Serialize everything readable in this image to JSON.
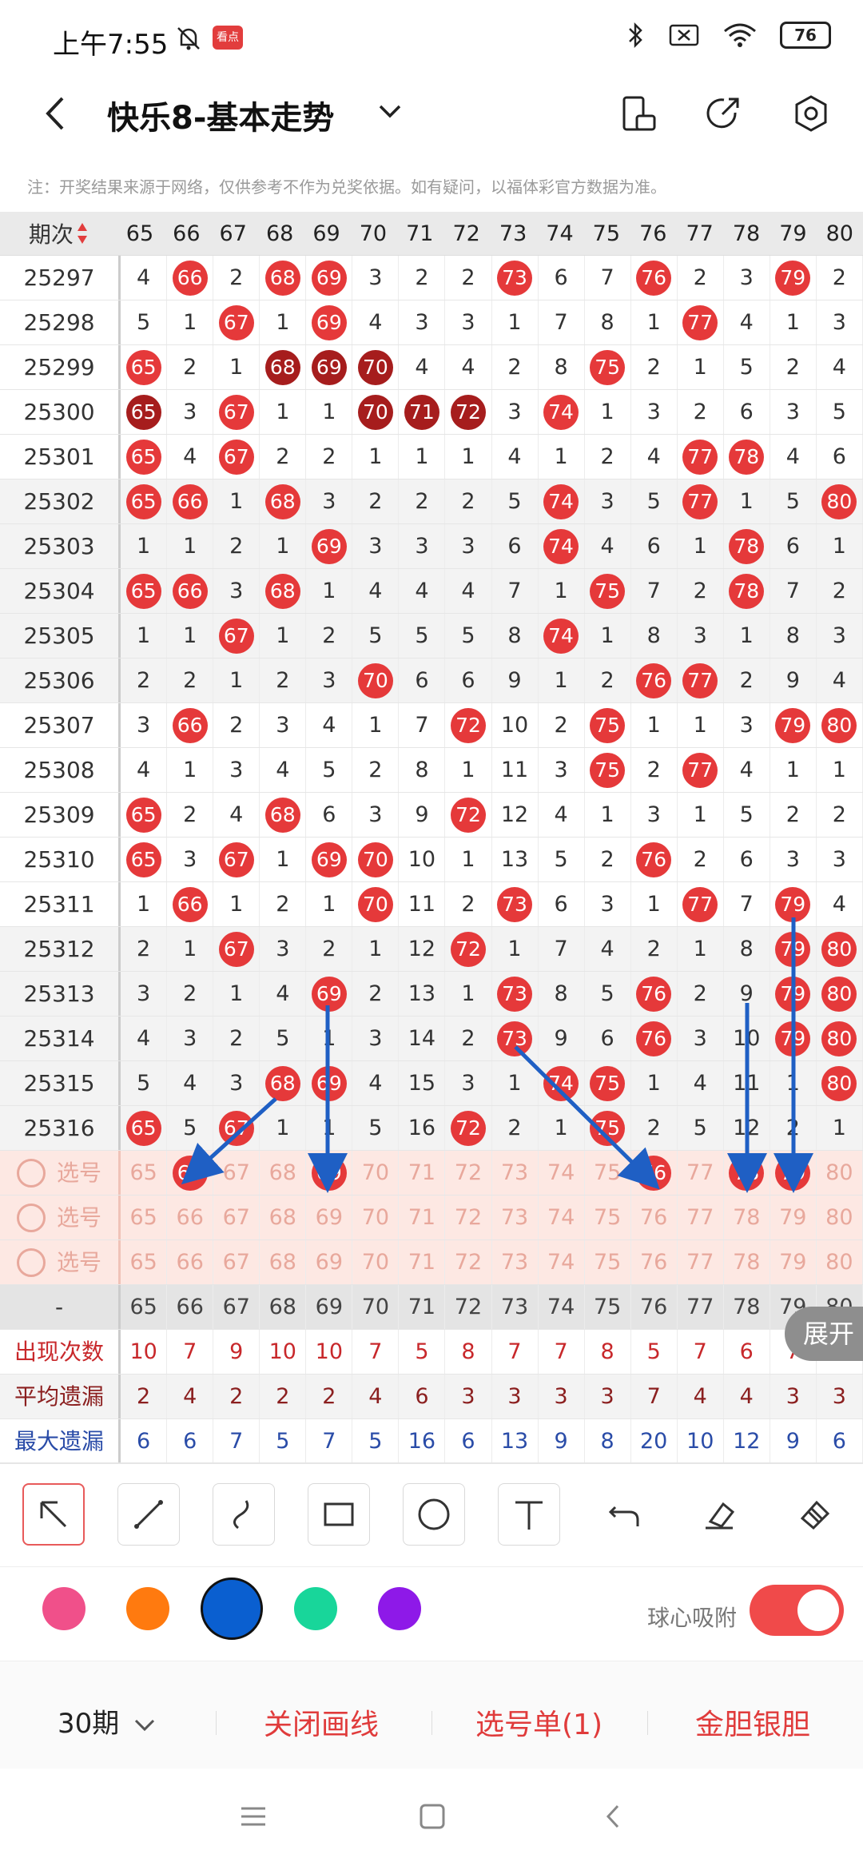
{
  "status_bar": {
    "time": "上午7:55",
    "app_badge": "看点",
    "battery": "76"
  },
  "header": {
    "title": "快乐8-基本走势"
  },
  "note": "注：开奖结果来源于网络，仅供参考不作为兑奖依据。如有疑问，以福体彩官方数据为准。",
  "table": {
    "period_header": "期次",
    "columns": [
      "65",
      "66",
      "67",
      "68",
      "69",
      "70",
      "71",
      "72",
      "73",
      "74",
      "75",
      "76",
      "77",
      "78",
      "79",
      "80"
    ],
    "rows": [
      {
        "period": "25297",
        "cells": [
          "4",
          "66",
          "2",
          "68",
          "69",
          "3",
          "2",
          "2",
          "73",
          "6",
          "7",
          "76",
          "2",
          "3",
          "79",
          "2"
        ]
      },
      {
        "period": "25298",
        "cells": [
          "5",
          "1",
          "67",
          "1",
          "69",
          "4",
          "3",
          "3",
          "1",
          "7",
          "8",
          "1",
          "77",
          "4",
          "1",
          "3"
        ]
      },
      {
        "period": "25299",
        "cells": [
          "65",
          "2",
          "1",
          "68",
          "69",
          "70",
          "4",
          "4",
          "2",
          "8",
          "75",
          "2",
          "1",
          "5",
          "2",
          "4"
        ]
      },
      {
        "period": "25300",
        "cells": [
          "65",
          "3",
          "67",
          "1",
          "1",
          "70",
          "71",
          "72",
          "3",
          "74",
          "1",
          "3",
          "2",
          "6",
          "3",
          "5"
        ]
      },
      {
        "period": "25301",
        "cells": [
          "65",
          "4",
          "67",
          "2",
          "2",
          "1",
          "1",
          "1",
          "4",
          "1",
          "2",
          "4",
          "77",
          "78",
          "4",
          "6"
        ]
      },
      {
        "period": "25302",
        "cells": [
          "65",
          "66",
          "1",
          "68",
          "3",
          "2",
          "2",
          "2",
          "5",
          "74",
          "3",
          "5",
          "77",
          "1",
          "5",
          "80"
        ]
      },
      {
        "period": "25303",
        "cells": [
          "1",
          "1",
          "2",
          "1",
          "69",
          "3",
          "3",
          "3",
          "6",
          "74",
          "4",
          "6",
          "1",
          "78",
          "6",
          "1"
        ]
      },
      {
        "period": "25304",
        "cells": [
          "65",
          "66",
          "3",
          "68",
          "1",
          "4",
          "4",
          "4",
          "7",
          "1",
          "75",
          "7",
          "2",
          "78",
          "7",
          "2"
        ]
      },
      {
        "period": "25305",
        "cells": [
          "1",
          "1",
          "67",
          "1",
          "2",
          "5",
          "5",
          "5",
          "8",
          "74",
          "1",
          "8",
          "3",
          "1",
          "8",
          "3"
        ]
      },
      {
        "period": "25306",
        "cells": [
          "2",
          "2",
          "1",
          "2",
          "3",
          "70",
          "6",
          "6",
          "9",
          "1",
          "2",
          "76",
          "77",
          "2",
          "9",
          "4"
        ]
      },
      {
        "period": "25307",
        "cells": [
          "3",
          "66",
          "2",
          "3",
          "4",
          "1",
          "7",
          "72",
          "10",
          "2",
          "75",
          "1",
          "1",
          "3",
          "79",
          "80"
        ]
      },
      {
        "period": "25308",
        "cells": [
          "4",
          "1",
          "3",
          "4",
          "5",
          "2",
          "8",
          "1",
          "11",
          "3",
          "75",
          "2",
          "77",
          "4",
          "1",
          "1"
        ]
      },
      {
        "period": "25309",
        "cells": [
          "65",
          "2",
          "4",
          "68",
          "6",
          "3",
          "9",
          "72",
          "12",
          "4",
          "1",
          "3",
          "1",
          "5",
          "2",
          "2"
        ]
      },
      {
        "period": "25310",
        "cells": [
          "65",
          "3",
          "67",
          "1",
          "69",
          "70",
          "10",
          "1",
          "13",
          "5",
          "2",
          "76",
          "2",
          "6",
          "3",
          "3"
        ]
      },
      {
        "period": "25311",
        "cells": [
          "1",
          "66",
          "1",
          "2",
          "1",
          "70",
          "11",
          "2",
          "73",
          "6",
          "3",
          "1",
          "77",
          "7",
          "79",
          "4"
        ]
      },
      {
        "period": "25312",
        "cells": [
          "2",
          "1",
          "67",
          "3",
          "2",
          "1",
          "12",
          "72",
          "1",
          "7",
          "4",
          "2",
          "1",
          "8",
          "79",
          "80"
        ]
      },
      {
        "period": "25313",
        "cells": [
          "3",
          "2",
          "1",
          "4",
          "69",
          "2",
          "13",
          "1",
          "73",
          "8",
          "5",
          "76",
          "2",
          "9",
          "79",
          "80"
        ]
      },
      {
        "period": "25314",
        "cells": [
          "4",
          "3",
          "2",
          "5",
          "1",
          "3",
          "14",
          "2",
          "73",
          "9",
          "6",
          "76",
          "3",
          "10",
          "79",
          "80"
        ]
      },
      {
        "period": "25315",
        "cells": [
          "5",
          "4",
          "3",
          "68",
          "69",
          "4",
          "15",
          "3",
          "1",
          "74",
          "75",
          "1",
          "4",
          "11",
          "1",
          "80"
        ]
      },
      {
        "period": "25316",
        "cells": [
          "65",
          "5",
          "67",
          "1",
          "1",
          "5",
          "16",
          "72",
          "2",
          "1",
          "75",
          "2",
          "5",
          "12",
          "2",
          "1"
        ]
      }
    ],
    "dark_balls": [
      "25299-68",
      "25299-69",
      "25299-70",
      "25300-65",
      "25300-70",
      "25300-71",
      "25300-72"
    ],
    "select_label": "选号",
    "select_rows": [
      {
        "picked": [
          "66",
          "69",
          "76",
          "78",
          "79"
        ]
      },
      {
        "picked": []
      },
      {
        "picked": []
      }
    ],
    "footer_dash": "-",
    "stats": [
      {
        "label": "出现次数",
        "values": [
          "10",
          "7",
          "9",
          "10",
          "10",
          "7",
          "5",
          "8",
          "7",
          "7",
          "8",
          "5",
          "7",
          "6",
          "7",
          "8"
        ]
      },
      {
        "label": "平均遗漏",
        "values": [
          "2",
          "4",
          "2",
          "2",
          "2",
          "4",
          "6",
          "3",
          "3",
          "3",
          "3",
          "7",
          "4",
          "4",
          "3",
          "3"
        ]
      },
      {
        "label": "最大遗漏",
        "values": [
          "6",
          "6",
          "7",
          "5",
          "7",
          "5",
          "16",
          "6",
          "13",
          "9",
          "8",
          "20",
          "10",
          "12",
          "9",
          "6"
        ]
      }
    ],
    "expand_label": "展开"
  },
  "tools": {
    "items": [
      "pointer-icon",
      "line-icon",
      "curve-icon",
      "rect-icon",
      "circle-icon",
      "text-icon",
      "undo-icon",
      "eraser-icon",
      "clear-icon"
    ]
  },
  "colors": {
    "swatches": [
      "#f0508a",
      "#ff7a0f",
      "#0a5fd0",
      "#18d69a",
      "#8e19e8"
    ],
    "selected": "#0a5fd0",
    "toggle_label": "球心吸附",
    "toggle_on": true
  },
  "actions": {
    "period": "30期",
    "close_lines": "关闭画线",
    "pick_list": "选号单(1)",
    "gold_silver": "金胆银胆"
  },
  "annotation_color": "#1f5fc4"
}
